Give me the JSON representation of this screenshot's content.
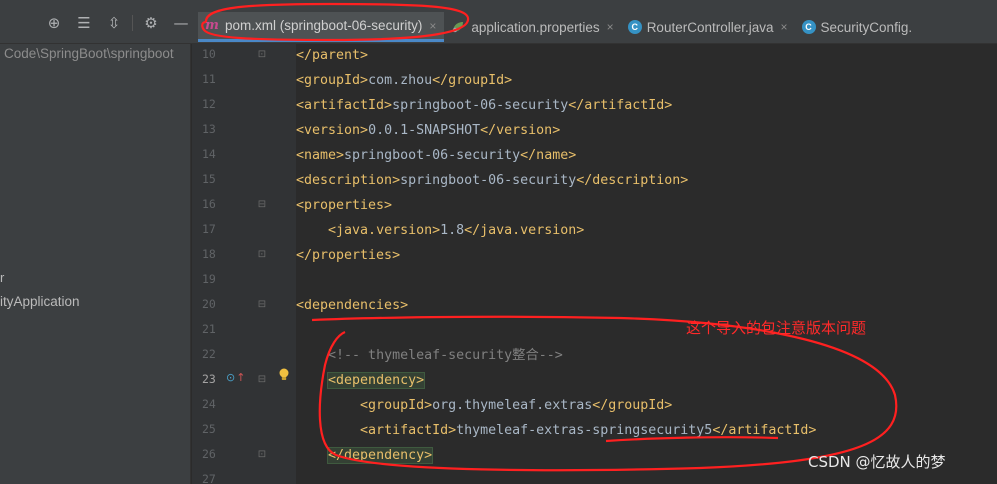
{
  "toolbar": {
    "icons": [
      "target-icon",
      "expand-all-icon",
      "collapse-all-icon",
      "gear-icon",
      "hide-icon"
    ],
    "glyphs": [
      "⊕",
      "☰",
      "⇳",
      "⚙",
      "—"
    ]
  },
  "tabs": [
    {
      "label": "pom.xml (springboot-06-security)",
      "icon": "m",
      "active": true
    },
    {
      "label": "application.properties",
      "icon": "leaf",
      "active": false
    },
    {
      "label": "RouterController.java",
      "icon": "c",
      "active": false
    },
    {
      "label": "SecurityConfig.",
      "icon": "c",
      "active": false
    }
  ],
  "close_glyph": "×",
  "project_panel": {
    "path": "Code\\SpringBoot\\springboot",
    "tree_item_1": "r",
    "tree_item_2": "ityApplication"
  },
  "editor": {
    "current_line": 23,
    "lines": [
      {
        "n": 10,
        "code": "</parent>"
      },
      {
        "n": 11,
        "code": "<groupId>com.zhou</groupId>"
      },
      {
        "n": 12,
        "code": "<artifactId>springboot-06-security</artifactId>"
      },
      {
        "n": 13,
        "code": "<version>0.0.1-SNAPSHOT</version>"
      },
      {
        "n": 14,
        "code": "<name>springboot-06-security</name>"
      },
      {
        "n": 15,
        "code": "<description>springboot-06-security</description>"
      },
      {
        "n": 16,
        "code": "<properties>"
      },
      {
        "n": 17,
        "code": "    <java.version>1.8</java.version>"
      },
      {
        "n": 18,
        "code": "</properties>"
      },
      {
        "n": 19,
        "code": ""
      },
      {
        "n": 20,
        "code": "<dependencies>"
      },
      {
        "n": 21,
        "code": ""
      },
      {
        "n": 22,
        "code": "    <!-- thymeleaf-security整合-->"
      },
      {
        "n": 23,
        "code": "    <dependency>"
      },
      {
        "n": 24,
        "code": "        <groupId>org.thymeleaf.extras</groupId>"
      },
      {
        "n": 25,
        "code": "        <artifactId>thymeleaf-extras-springsecurity5</artifactId>"
      },
      {
        "n": 26,
        "code": "    </dependency>"
      },
      {
        "n": 27,
        "code": ""
      }
    ]
  },
  "annotation_note": "这个导入的包注意版本问题",
  "watermark": "CSDN @忆故人的梦",
  "colors": {
    "tag": "#e8bf6a",
    "text": "#a9b7c6",
    "comment": "#808080",
    "annotation": "#ff2a2a",
    "accent": "#4a88c7"
  }
}
